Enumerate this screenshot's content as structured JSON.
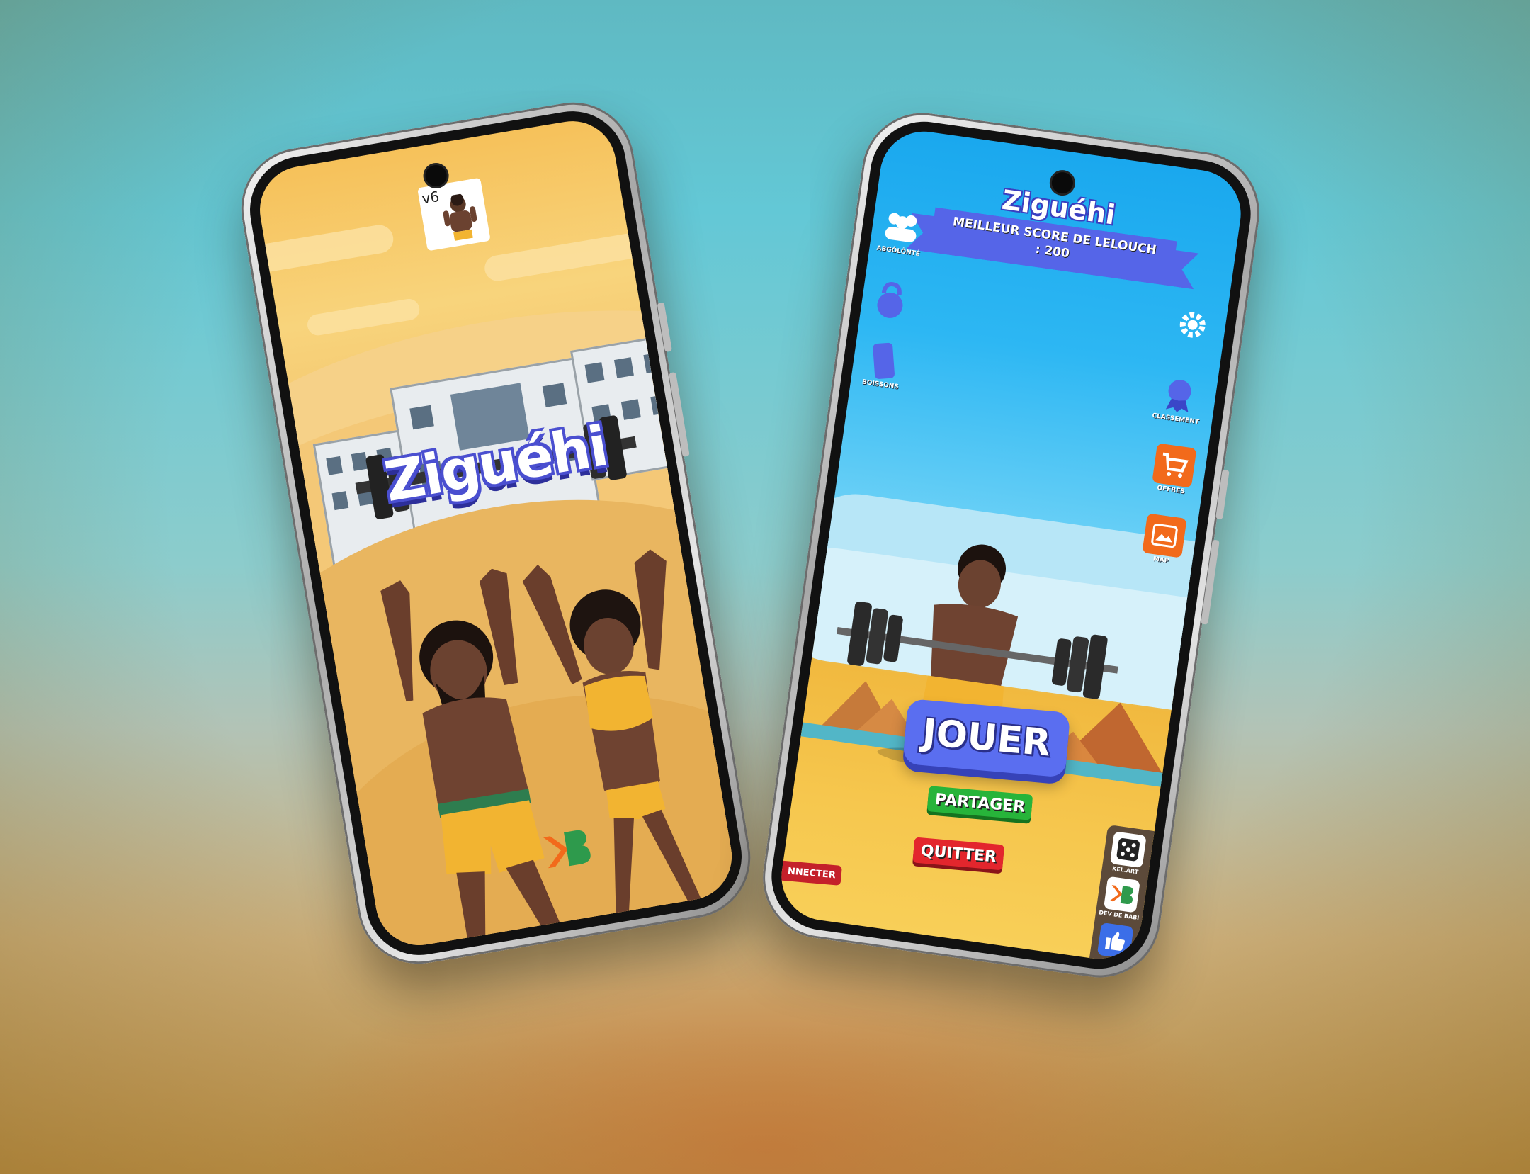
{
  "left_screen": {
    "version_label": "v6",
    "game_title": "Ziguéhi"
  },
  "right_screen": {
    "game_title": "Ziguéhi",
    "best_score_text": "MEILLEUR SCORE DE LELOUCH : 200",
    "left_menu": [
      {
        "label": "ABGÔLÔNTÉ",
        "icon": "group-icon"
      },
      {
        "label": "",
        "icon": "kettlebell-icon"
      },
      {
        "label": "BOISSONS",
        "icon": "drink-icon"
      }
    ],
    "right_menu": [
      {
        "label": "",
        "icon": "gear-icon"
      },
      {
        "label": "CLASSEMENT",
        "icon": "medal-icon"
      },
      {
        "label": "OFFRES",
        "icon": "cart-icon"
      },
      {
        "label": "MAP",
        "icon": "map-icon"
      }
    ],
    "play_button": "JOUER",
    "share_button": "PARTAGER",
    "quit_button": "QUITTER",
    "connect_button": "NNECTER",
    "dock": [
      {
        "label": "KEL.ART",
        "icon": "dice-icon"
      },
      {
        "label": "DEV DE BABI",
        "icon": "studio-logo-icon"
      },
      {
        "label": "",
        "icon": "thumbs-up-icon"
      }
    ]
  },
  "colors": {
    "button_blue": "#5a6ef0",
    "button_green": "#27b43a",
    "button_red": "#e3262d",
    "offer_orange": "#f26a1b"
  }
}
